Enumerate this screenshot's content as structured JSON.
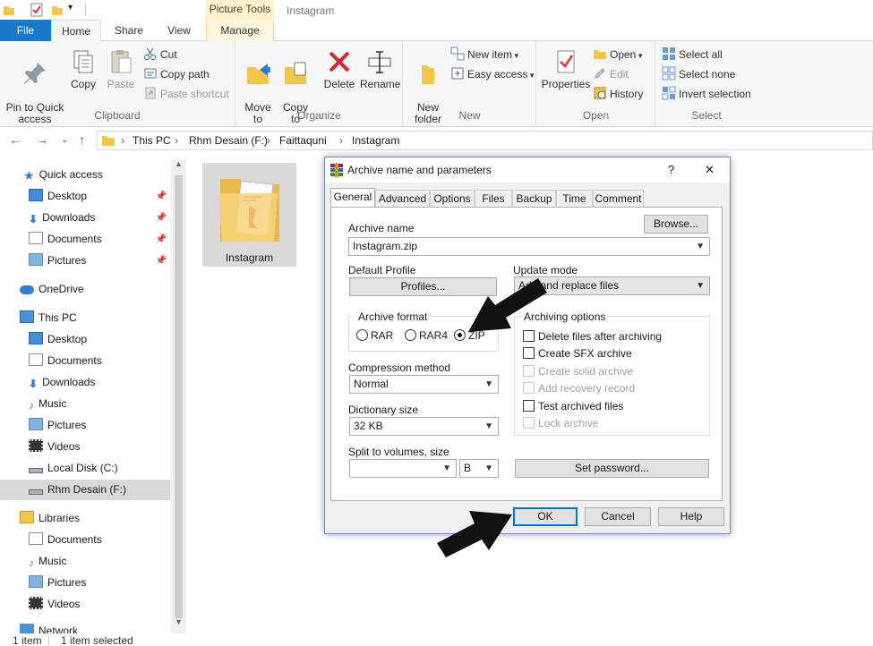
{
  "window": {
    "title": "Instagram",
    "context_tab_group": "Picture Tools"
  },
  "tabs": [
    {
      "label": "File"
    },
    {
      "label": "Home"
    },
    {
      "label": "Share"
    },
    {
      "label": "View"
    },
    {
      "label": "Manage"
    }
  ],
  "ribbon": {
    "clipboard": {
      "label": "Clipboard",
      "pin": "Pin to Quick\naccess",
      "copy": "Copy",
      "paste": "Paste",
      "cut": "Cut",
      "copy_path": "Copy path",
      "paste_shortcut": "Paste shortcut"
    },
    "organize": {
      "label": "Organize",
      "move_to": "Move\nto",
      "copy_to": "Copy\nto",
      "delete": "Delete",
      "rename": "Rename"
    },
    "new": {
      "label": "New",
      "new_folder": "New\nfolder",
      "new_item": "New item",
      "easy_access": "Easy access"
    },
    "open": {
      "label": "Open",
      "properties": "Properties",
      "open": "Open",
      "edit": "Edit",
      "history": "History"
    },
    "select": {
      "label": "Select",
      "select_all": "Select all",
      "select_none": "Select none",
      "invert": "Invert selection"
    }
  },
  "address": {
    "crumbs": [
      "This PC",
      "Rhm Desain (F:)",
      "Faittaquni",
      "Instagram"
    ]
  },
  "nav": {
    "items": [
      {
        "label": "Quick access"
      },
      {
        "label": "Desktop"
      },
      {
        "label": "Downloads"
      },
      {
        "label": "Documents"
      },
      {
        "label": "Pictures"
      },
      {
        "label": "OneDrive"
      },
      {
        "label": "This PC"
      },
      {
        "label": "Desktop"
      },
      {
        "label": "Documents"
      },
      {
        "label": "Downloads"
      },
      {
        "label": "Music"
      },
      {
        "label": "Pictures"
      },
      {
        "label": "Videos"
      },
      {
        "label": "Local Disk (C:)"
      },
      {
        "label": "Rhm Desain (F:)"
      },
      {
        "label": "Libraries"
      },
      {
        "label": "Documents"
      },
      {
        "label": "Music"
      },
      {
        "label": "Pictures"
      },
      {
        "label": "Videos"
      },
      {
        "label": "Network"
      }
    ]
  },
  "content": {
    "folder_name": "Instagram"
  },
  "status": {
    "count": "1 item",
    "selected": "1 item selected"
  },
  "dialog": {
    "title": "Archive name and parameters",
    "help": "?",
    "close": "✕",
    "tabs": [
      "General",
      "Advanced",
      "Options",
      "Files",
      "Backup",
      "Time",
      "Comment"
    ],
    "archive_name_label": "Archive name",
    "archive_name_value": "Instagram.zip",
    "browse": "Browse...",
    "default_profile_label": "Default Profile",
    "profiles": "Profiles...",
    "update_mode_label": "Update mode",
    "update_mode_value": "Add and replace files",
    "archive_format_label": "Archive format",
    "formats": [
      "RAR",
      "RAR4",
      "ZIP"
    ],
    "selected_format": "ZIP",
    "compression_label": "Compression method",
    "compression_value": "Normal",
    "dictionary_label": "Dictionary size",
    "dictionary_value": "32 KB",
    "split_label": "Split to volumes, size",
    "split_unit": "B",
    "options_label": "Archiving options",
    "options": [
      {
        "label": "Delete files after archiving",
        "enabled": true
      },
      {
        "label": "Create SFX archive",
        "enabled": true
      },
      {
        "label": "Create solid archive",
        "enabled": false
      },
      {
        "label": "Add recovery record",
        "enabled": false
      },
      {
        "label": "Test archived files",
        "enabled": true
      },
      {
        "label": "Lock archive",
        "enabled": false
      }
    ],
    "set_password": "Set password...",
    "ok": "OK",
    "cancel": "Cancel",
    "help_button": "Help"
  },
  "colors": {
    "accent": "#1979ca",
    "context_tab": "#fdf2c9",
    "ok_border": "#0078d7"
  }
}
